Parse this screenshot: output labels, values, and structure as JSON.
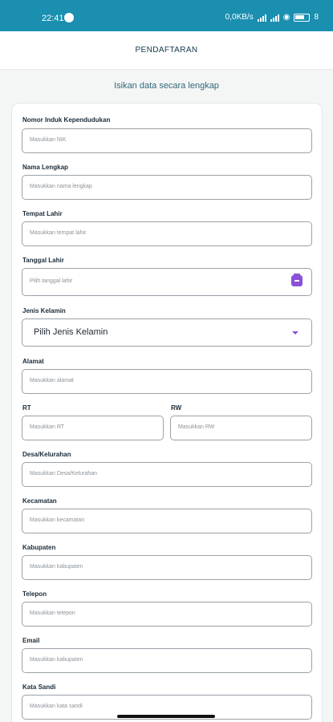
{
  "status": {
    "time": "22:41",
    "speed": "0,0KB/s",
    "battery": "8"
  },
  "header": {
    "title": "PENDAFTARAN"
  },
  "subtitle": "Isikan data secara lengkap",
  "fields": {
    "nik": {
      "label": "Nomor Induk Kependudukan",
      "placeholder": "Masukkan NIK"
    },
    "nama": {
      "label": "Nama Lengkap",
      "placeholder": "Masukkan nama lengkap"
    },
    "tempat_lahir": {
      "label": "Tempat Lahir",
      "placeholder": "Masukkan tempat lahir"
    },
    "tanggal_lahir": {
      "label": "Tanggal Lahir",
      "placeholder": "Pilih tanggal lahir"
    },
    "jenis_kelamin": {
      "label": "Jenis Kelamin",
      "value": "Pilih Jenis Kelamin"
    },
    "alamat": {
      "label": "Alamat",
      "placeholder": "Masukkan alamat"
    },
    "rt": {
      "label": "RT",
      "placeholder": "Masukkan RT"
    },
    "rw": {
      "label": "RW",
      "placeholder": "Masukkan RW"
    },
    "desa": {
      "label": "Desa/Kelurahan",
      "placeholder": "Masukkan Desa/Kelurahan"
    },
    "kecamatan": {
      "label": "Kecamatan",
      "placeholder": "Masukkan kecamatan"
    },
    "kabupaten": {
      "label": "Kabupaten",
      "placeholder": "Masukkan kabupaten"
    },
    "telepon": {
      "label": "Telepon",
      "placeholder": "Masukkan telepon"
    },
    "email": {
      "label": "Email",
      "placeholder": "Masukkan kabupaten"
    },
    "kata_sandi": {
      "label": "Kata Sandi",
      "placeholder": "Masukkan kata sandi"
    }
  },
  "colors": {
    "status_bar": "#1a8fb0",
    "accent": "#8a51d9"
  },
  "icons": {
    "calendar": "calendar-icon",
    "dropdown": "chevron-down-icon"
  }
}
